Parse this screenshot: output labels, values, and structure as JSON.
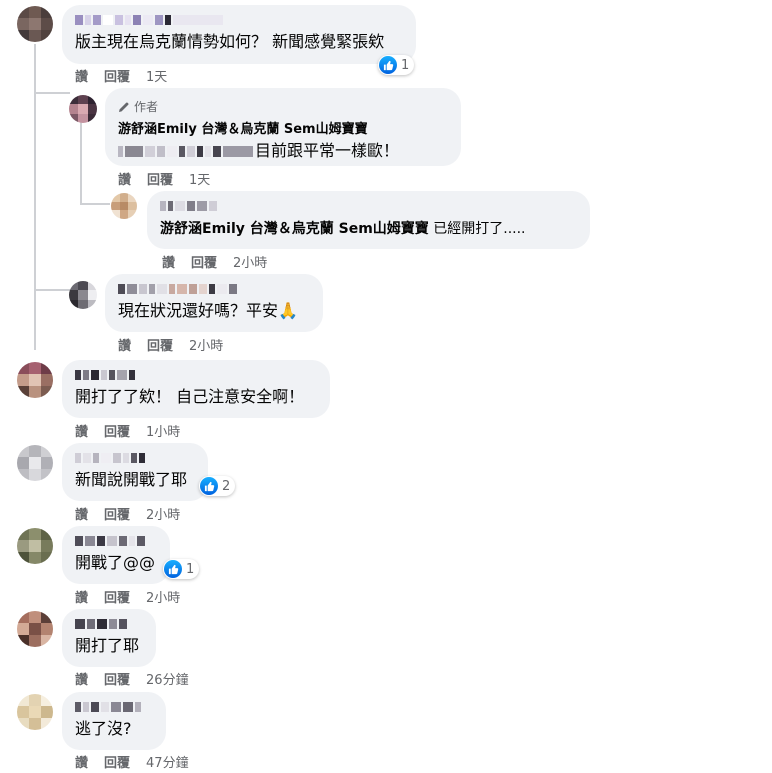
{
  "actions": {
    "like": "讚",
    "reply": "回覆"
  },
  "colors": {
    "bubble": "#f0f2f5",
    "meta": "#65676b",
    "like_blue": "#1877f2"
  },
  "comments": [
    {
      "text": "版主現在烏克蘭情勢如何？ 新聞感覺緊張欸",
      "time": "1天",
      "reactions": "1"
    },
    {
      "author_badge": "作者",
      "author_name": "游舒涵Emily 台灣＆烏克蘭 Sem山姆寶寶",
      "text": "目前跟平常一樣歐！",
      "time": "1天"
    },
    {
      "mention": "游舒涵Emily 台灣＆烏克蘭 Sem山姆寶寶",
      "text": " 已經開打了.....",
      "time": "2小時"
    },
    {
      "text": "現在狀況還好嗎？平安🙏",
      "time": "2小時"
    },
    {
      "text": "開打了了欸！ 自己注意安全啊！",
      "time": "1小時"
    },
    {
      "text": "新聞說開戰了耶",
      "time": "2小時",
      "reactions": "2"
    },
    {
      "text": "開戰了@@",
      "time": "2小時",
      "reactions": "1"
    },
    {
      "text": "開打了耶",
      "time": "26分鐘"
    },
    {
      "text": "逃了沒?",
      "time": "47分鐘"
    }
  ]
}
